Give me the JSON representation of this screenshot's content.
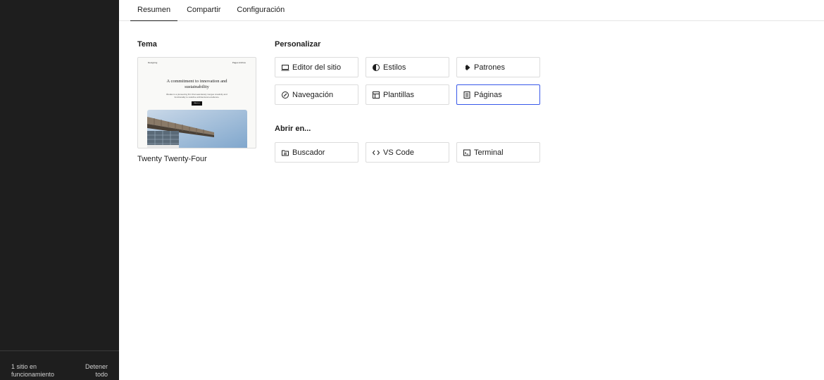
{
  "sidebar": {
    "status_line1": "1 sitio en",
    "status_line2": "funcionamiento",
    "stop_line1": "Detener",
    "stop_line2": "todo"
  },
  "tabs": [
    {
      "label": "Resumen",
      "active": true
    },
    {
      "label": "Compartir",
      "active": false
    },
    {
      "label": "Configuración",
      "active": false
    }
  ],
  "theme": {
    "section_title": "Tema",
    "name": "Twenty Twenty-Four",
    "preview": {
      "site_name": "Designing",
      "nav": "Pages  Archive",
      "headline_line1": "A commitment to innovation and",
      "headline_line2": "sustainability",
      "subtext": "Études is a pioneering firm that seamlessly merges creativity and functionality to redefine architectural excellence.",
      "button": "About us"
    }
  },
  "customize": {
    "section_title": "Personalizar",
    "buttons": [
      {
        "label": "Editor del sitio",
        "icon": "monitor-icon"
      },
      {
        "label": "Estilos",
        "icon": "half-circle-icon"
      },
      {
        "label": "Patrones",
        "icon": "diamond-icon"
      },
      {
        "label": "Navegación",
        "icon": "compass-icon"
      },
      {
        "label": "Plantillas",
        "icon": "layout-icon"
      },
      {
        "label": "Páginas",
        "icon": "page-icon"
      }
    ]
  },
  "open_in": {
    "section_title": "Abrir en...",
    "buttons": [
      {
        "label": "Buscador",
        "icon": "folder-icon"
      },
      {
        "label": "VS Code",
        "icon": "code-icon"
      },
      {
        "label": "Terminal",
        "icon": "terminal-icon"
      }
    ]
  },
  "colors": {
    "sidebar_bg": "#1e1e1e",
    "selected_border": "#3858e9"
  }
}
